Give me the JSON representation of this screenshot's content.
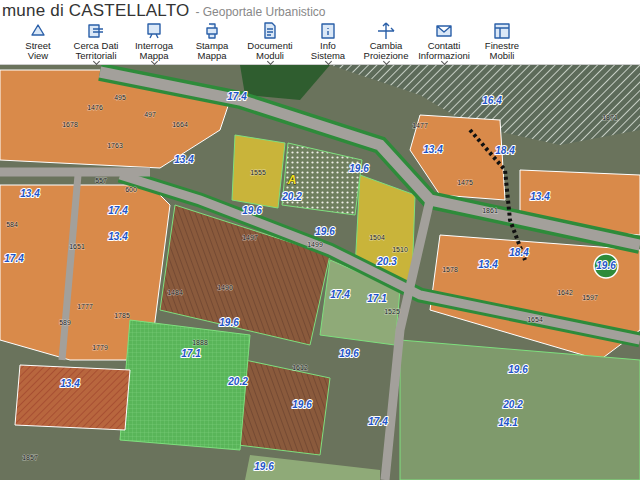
{
  "header": {
    "title": "mune di CASTELLALTO",
    "subtitle": "- Geoportale Urbanistico"
  },
  "toolbar": [
    {
      "lines": [
        "Street",
        "View"
      ],
      "dropdown": false
    },
    {
      "lines": [
        "Cerca Dati",
        "Territoriali"
      ],
      "dropdown": true
    },
    {
      "lines": [
        "Interroga",
        "Mappa"
      ],
      "dropdown": true
    },
    {
      "lines": [
        "Stampa",
        "Mappa"
      ],
      "dropdown": false
    },
    {
      "lines": [
        "Documenti",
        "Moduli"
      ],
      "dropdown": true
    },
    {
      "lines": [
        "Info",
        "Sistema"
      ],
      "dropdown": true
    },
    {
      "lines": [
        "Cambia",
        "Proiezione"
      ],
      "dropdown": true
    },
    {
      "lines": [
        "Contatti",
        "Informazioni"
      ],
      "dropdown": true
    },
    {
      "lines": [
        "Finestre",
        "Mobili"
      ],
      "dropdown": false
    }
  ],
  "map_labels": [
    {
      "text": "17.4",
      "kind": "zone"
    },
    {
      "text": "13.4",
      "kind": "zone"
    },
    {
      "text": "16.4",
      "kind": "zone"
    },
    {
      "text": "18.4",
      "kind": "zone"
    },
    {
      "text": "13.4",
      "kind": "zone"
    },
    {
      "text": "17.4",
      "kind": "zone"
    },
    {
      "text": "13.4",
      "kind": "zone"
    },
    {
      "text": "13.4",
      "kind": "zone"
    },
    {
      "text": "19.6",
      "kind": "zone"
    },
    {
      "text": "19.6",
      "kind": "zone"
    },
    {
      "text": "19.6",
      "kind": "zone"
    },
    {
      "text": "20.2",
      "kind": "zone"
    },
    {
      "text": "20.3",
      "kind": "zone"
    },
    {
      "text": "13.4",
      "kind": "zone"
    },
    {
      "text": "18.4",
      "kind": "zone"
    },
    {
      "text": "13.4",
      "kind": "zone"
    },
    {
      "text": "19.6",
      "kind": "zone"
    },
    {
      "text": "17.4",
      "kind": "zone"
    },
    {
      "text": "17.1",
      "kind": "zone"
    },
    {
      "text": "19.6",
      "kind": "zone"
    },
    {
      "text": "17.1",
      "kind": "zone"
    },
    {
      "text": "20.2",
      "kind": "zone"
    },
    {
      "text": "19.6",
      "kind": "zone"
    },
    {
      "text": "17.4",
      "kind": "zone"
    },
    {
      "text": "13.4",
      "kind": "zone"
    },
    {
      "text": "17.4",
      "kind": "zone"
    },
    {
      "text": "19.6",
      "kind": "zone"
    },
    {
      "text": "19.6",
      "kind": "zone"
    },
    {
      "text": "20.2",
      "kind": "zone"
    },
    {
      "text": "14.1",
      "kind": "zone"
    },
    {
      "text": "19.6",
      "kind": "zone"
    },
    {
      "text": "A",
      "kind": "marker"
    },
    {
      "text": "495",
      "kind": "parcel"
    },
    {
      "text": "1476",
      "kind": "parcel"
    },
    {
      "text": "497",
      "kind": "parcel"
    },
    {
      "text": "1664",
      "kind": "parcel"
    },
    {
      "text": "1678",
      "kind": "parcel"
    },
    {
      "text": "1763",
      "kind": "parcel"
    },
    {
      "text": "557",
      "kind": "parcel"
    },
    {
      "text": "600",
      "kind": "parcel"
    },
    {
      "text": "584",
      "kind": "parcel"
    },
    {
      "text": "1651",
      "kind": "parcel"
    },
    {
      "text": "1777",
      "kind": "parcel"
    },
    {
      "text": "1785",
      "kind": "parcel"
    },
    {
      "text": "589",
      "kind": "parcel"
    },
    {
      "text": "1779",
      "kind": "parcel"
    },
    {
      "text": "1497",
      "kind": "parcel"
    },
    {
      "text": "1499",
      "kind": "parcel"
    },
    {
      "text": "1504",
      "kind": "parcel"
    },
    {
      "text": "1510",
      "kind": "parcel"
    },
    {
      "text": "1525",
      "kind": "parcel"
    },
    {
      "text": "1477",
      "kind": "parcel"
    },
    {
      "text": "1475",
      "kind": "parcel"
    },
    {
      "text": "1861",
      "kind": "parcel"
    },
    {
      "text": "1871",
      "kind": "parcel"
    },
    {
      "text": "1642",
      "kind": "parcel"
    },
    {
      "text": "1597",
      "kind": "parcel"
    },
    {
      "text": "1654",
      "kind": "parcel"
    },
    {
      "text": "1578",
      "kind": "parcel"
    },
    {
      "text": "1484",
      "kind": "parcel"
    },
    {
      "text": "1490",
      "kind": "parcel"
    },
    {
      "text": "1888",
      "kind": "parcel"
    },
    {
      "text": "1612",
      "kind": "parcel"
    },
    {
      "text": "1857",
      "kind": "parcel"
    },
    {
      "text": "1555",
      "kind": "parcel"
    }
  ]
}
